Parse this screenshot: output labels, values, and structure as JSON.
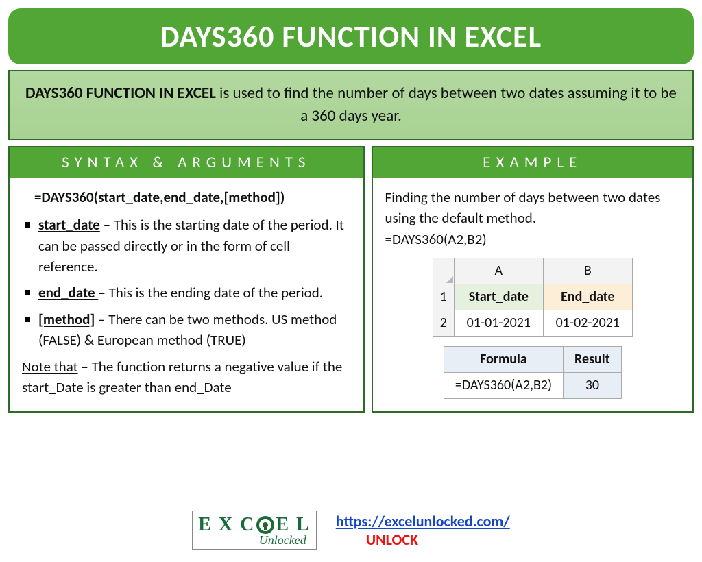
{
  "title": "DAYS360 FUNCTION IN EXCEL",
  "description": {
    "lead": "DAYS360 FUNCTION IN EXCEL",
    "rest": " is used to find the number of days between two dates assuming it to be a 360 days year."
  },
  "syntax": {
    "heading": "SYNTAX & ARGUMENTS",
    "formula": "=DAYS360(start_date,end_date,[method])",
    "args": [
      {
        "name": "start_date",
        "desc": " – This is the starting date of the period. It can be passed directly or in the form of cell reference."
      },
      {
        "name": "end_date ",
        "desc": "– This is the ending date of the period."
      },
      {
        "name": "[method]",
        "desc": " – There can be two methods. US method (FALSE) & European method (TRUE)"
      }
    ],
    "note_label": "Note that",
    "note_text": " – The function returns a negative value if the start_Date is greater than end_Date"
  },
  "example": {
    "heading": "EXAMPLE",
    "intro": "Finding the number of days between two dates using the default method.",
    "call": "=DAYS360(A2,B2)",
    "grid": {
      "colA": "A",
      "colB": "B",
      "row1": "1",
      "row2": "2",
      "a1": "Start_date",
      "b1": "End_date",
      "a2": "01-01-2021",
      "b2": "01-02-2021"
    },
    "result": {
      "h1": "Formula",
      "h2": "Result",
      "c1": "=DAYS360(A2,B2)",
      "c2": "30"
    }
  },
  "footer": {
    "logo_top_1": "E X C",
    "logo_top_2": "E L",
    "logo_sub": "Unlocked",
    "url": "https://excelunlocked.com/",
    "unlock": "UNLOCK"
  }
}
